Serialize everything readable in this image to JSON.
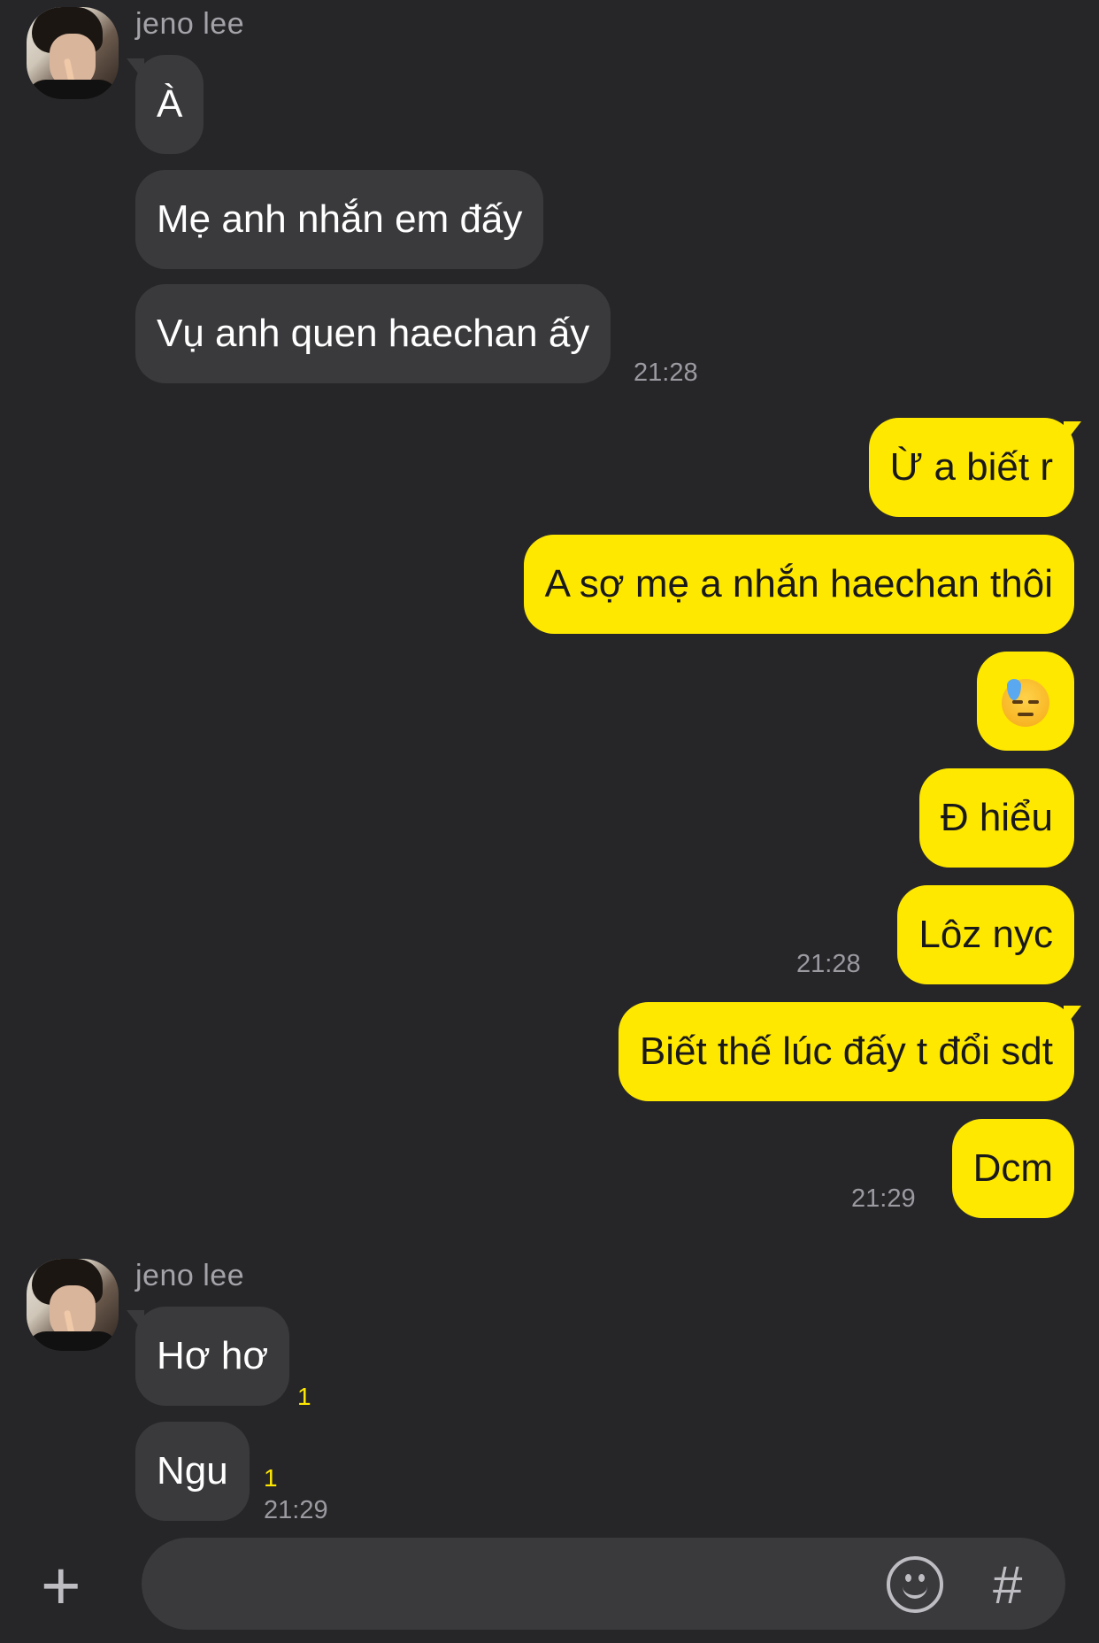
{
  "contact": {
    "name": "jeno lee"
  },
  "messages": [
    {
      "text": "À"
    },
    {
      "text": "Mẹ anh nhắn em đấy"
    },
    {
      "text": "Vụ anh quen haechan ấy"
    },
    {
      "text": "Ừ a biết r"
    },
    {
      "text": "A sợ mẹ a nhắn haechan thôi"
    },
    {
      "text": "😓"
    },
    {
      "text": "Đ hiểu"
    },
    {
      "text": "Lôz nyc"
    },
    {
      "text": "Biết thế lúc đấy t đổi sdt"
    },
    {
      "text": "Dcm"
    },
    {
      "text": "Hơ hơ"
    },
    {
      "text": "Ngu"
    }
  ],
  "times": [
    "21:28",
    "21:28",
    "21:29",
    "21:29"
  ],
  "unread": [
    "1",
    "1"
  ],
  "input": {
    "placeholder": ""
  },
  "icons": {
    "add": "plus-icon",
    "emoticon": "emoticon-icon",
    "hashtag": "hash-icon",
    "hashtag_glyph": "#"
  },
  "colors": {
    "background": "#262629",
    "incoming_bubble": "#3a3a3d",
    "outgoing_bubble": "#ffe800",
    "unread_count": "#ffe800"
  }
}
